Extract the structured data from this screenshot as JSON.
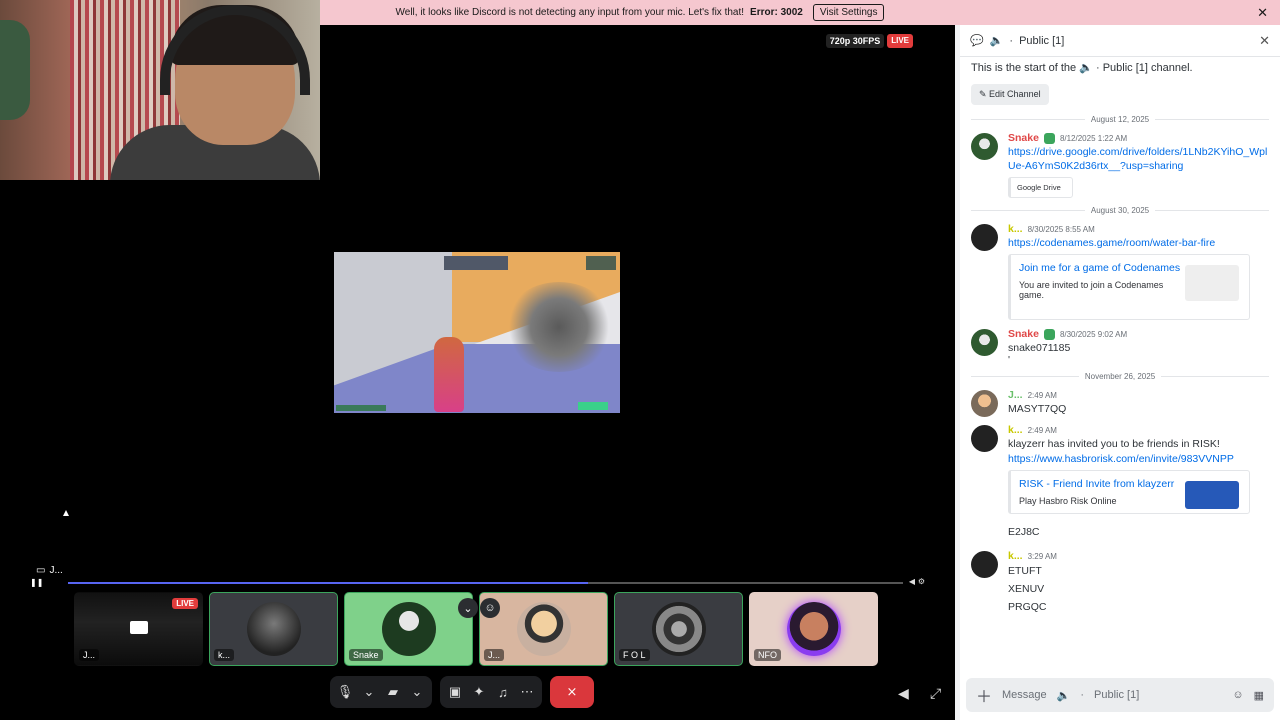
{
  "banner": {
    "message": "Well, it looks like Discord is not detecting any input from your mic. Let's fix that!",
    "error": "Error: 3002",
    "action": "Visit Settings",
    "close": "✕"
  },
  "stream": {
    "quality": "720p 30FPS",
    "live": "LIVE",
    "streamer_label": "J..."
  },
  "tiles": [
    {
      "label": "J...",
      "live": "LIVE"
    },
    {
      "label": "k..."
    },
    {
      "label": "Snake"
    },
    {
      "label": "J..."
    },
    {
      "label": "F O L"
    },
    {
      "label": "NFO"
    }
  ],
  "chat": {
    "channel": "Public [1]",
    "start_prefix": "This is the start of the",
    "start_suffix": "Public [1] channel.",
    "edit_button": "Edit Channel",
    "dates": [
      "August 12, 2025",
      "August 30, 2025",
      "November 26, 2025"
    ],
    "messages": [
      {
        "author": "Snake",
        "time": "8/12/2025 1:22 AM",
        "link": "https://drive.google.com/drive/folders/1LNb2KYihO_WplUe-A6YmS0K2d36rtx__?usp=sharing",
        "embed_desc": "Google Drive"
      },
      {
        "author": "k...",
        "time": "8/30/2025 8:55 AM",
        "link": "https://codenames.game/room/water-bar-fire",
        "embed_title": "Join me for a game of Codenames",
        "embed_desc": "You are invited to join a Codenames game."
      },
      {
        "author": "Snake",
        "time": "8/30/2025 9:02 AM",
        "text": "snake071185",
        "text2": "'"
      },
      {
        "author": "J...",
        "time": "2:49 AM",
        "text": "MASYT7QQ"
      },
      {
        "author": "k...",
        "time": "2:49 AM",
        "text": "klayzerr has invited you to be friends in RISK!",
        "link": "https://www.hasbrorisk.com/en/invite/983VVNPP",
        "embed_title": "RISK - Friend Invite from klayzerr",
        "embed_desc": "Play Hasbro Risk Online",
        "after": "E2J8C"
      },
      {
        "author": "k...",
        "time": "3:29 AM",
        "lines": [
          "ETUFT",
          "XENUV",
          "PRGQC"
        ]
      }
    ],
    "composer_prefix": "Message",
    "composer_channel": "Public [1]"
  }
}
